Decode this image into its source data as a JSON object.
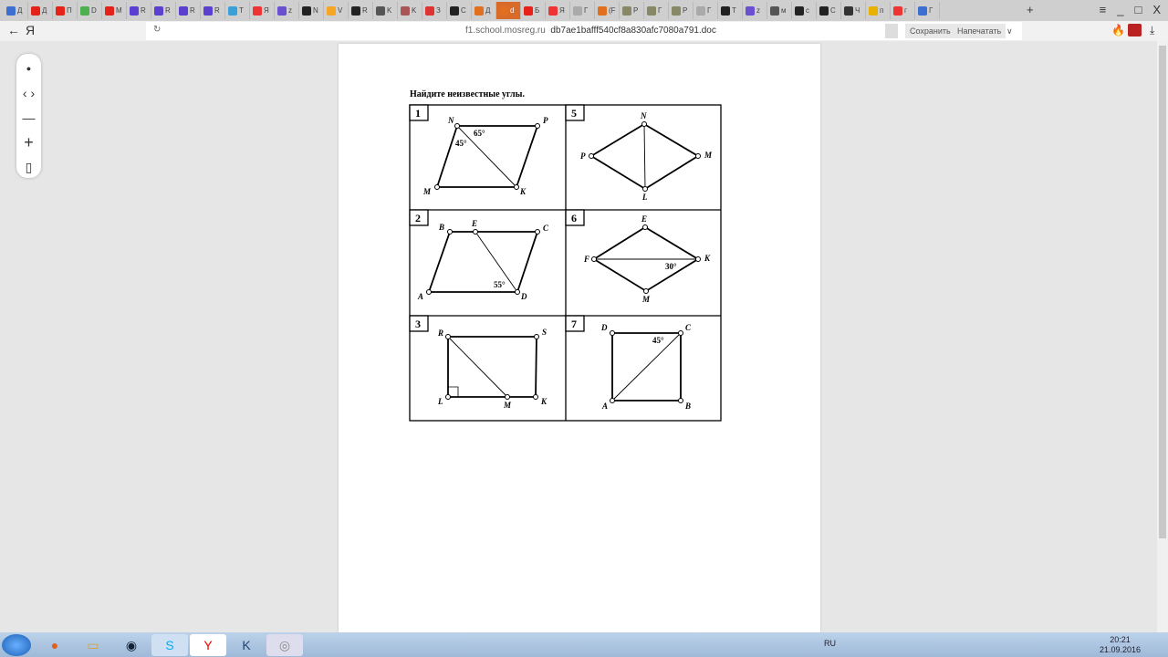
{
  "tabs": [
    {
      "l": "Д",
      "c": "#3b6fd1"
    },
    {
      "l": "Д",
      "c": "#e62117"
    },
    {
      "l": "П",
      "c": "#e62117"
    },
    {
      "l": "D",
      "c": "#4caf50"
    },
    {
      "l": "M",
      "c": "#e62117"
    },
    {
      "l": "R",
      "c": "#5a3fd1"
    },
    {
      "l": "R",
      "c": "#5a3fd1"
    },
    {
      "l": "R",
      "c": "#5a3fd1"
    },
    {
      "l": "R",
      "c": "#5a3fd1"
    },
    {
      "l": "T",
      "c": "#3aa0d8"
    },
    {
      "l": "Я",
      "c": "#e33"
    },
    {
      "l": "z",
      "c": "#6a4fd1"
    },
    {
      "l": "N",
      "c": "#222"
    },
    {
      "l": "V",
      "c": "#f5a623"
    },
    {
      "l": "R",
      "c": "#222"
    },
    {
      "l": "K",
      "c": "#555"
    },
    {
      "l": "K",
      "c": "#a55"
    },
    {
      "l": "З",
      "c": "#d33"
    },
    {
      "l": "С",
      "c": "#222"
    },
    {
      "l": "Д",
      "c": "#e07020"
    },
    {
      "l": "d",
      "c": "#e07020",
      "active": true
    },
    {
      "l": "Б",
      "c": "#e62117"
    },
    {
      "l": "Я",
      "c": "#e33"
    },
    {
      "l": "Г",
      "c": "#aaa"
    },
    {
      "l": "(F",
      "c": "#e07020"
    },
    {
      "l": "P",
      "c": "#886"
    },
    {
      "l": "Г",
      "c": "#886"
    },
    {
      "l": "P",
      "c": "#886"
    },
    {
      "l": "Г",
      "c": "#aaa"
    },
    {
      "l": "T",
      "c": "#222"
    },
    {
      "l": "z",
      "c": "#6a4fd1"
    },
    {
      "l": "м",
      "c": "#555"
    },
    {
      "l": "c",
      "c": "#222"
    },
    {
      "l": "C",
      "c": "#222"
    },
    {
      "l": "Ч",
      "c": "#333"
    },
    {
      "l": "п",
      "c": "#e8b000"
    },
    {
      "l": "г",
      "c": "#e33"
    },
    {
      "l": "Г",
      "c": "#3b6fd1"
    }
  ],
  "window": {
    "new_tab": "+",
    "menu": "≡",
    "minimize": "_",
    "maximize": "□",
    "close": "X"
  },
  "address": {
    "back": "←",
    "logo": "Я",
    "reload": "↻",
    "domain": "f1.school.mosreg.ru",
    "path": "db7ae1bafff540cf8a830afc7080a791.doc",
    "save": "Сохранить",
    "print": "Напечатать",
    "more": "∨"
  },
  "tools": {
    "pointer": "●",
    "nav": "‹ ›",
    "zoom_out": "—",
    "zoom_in": "+",
    "fit": "▯"
  },
  "doc": {
    "heading": "Найдите неизвестные углы.",
    "figures": [
      {
        "num": "1",
        "labels": {
          "N": "N",
          "P": "P",
          "K": "K",
          "M": "M"
        },
        "angles": [
          "65°",
          "45°"
        ]
      },
      {
        "num": "5",
        "labels": {
          "N": "N",
          "M": "M",
          "L": "L",
          "P": "P"
        }
      },
      {
        "num": "2",
        "labels": {
          "B": "B",
          "E": "E",
          "C": "C",
          "D": "D",
          "A": "A"
        },
        "angles": [
          "55°"
        ]
      },
      {
        "num": "6",
        "labels": {
          "E": "E",
          "K": "K",
          "M": "M",
          "F": "F"
        },
        "angles": [
          "30°"
        ]
      },
      {
        "num": "3",
        "labels": {
          "R": "R",
          "S": "S",
          "K": "K",
          "L": "L",
          "M": "M"
        }
      },
      {
        "num": "7",
        "labels": {
          "D": "D",
          "C": "C",
          "B": "B",
          "A": "A"
        },
        "angles": [
          "45°"
        ]
      }
    ]
  },
  "tray": {
    "lang": "RU",
    "time": "20:21",
    "date": "21.09.2016"
  }
}
